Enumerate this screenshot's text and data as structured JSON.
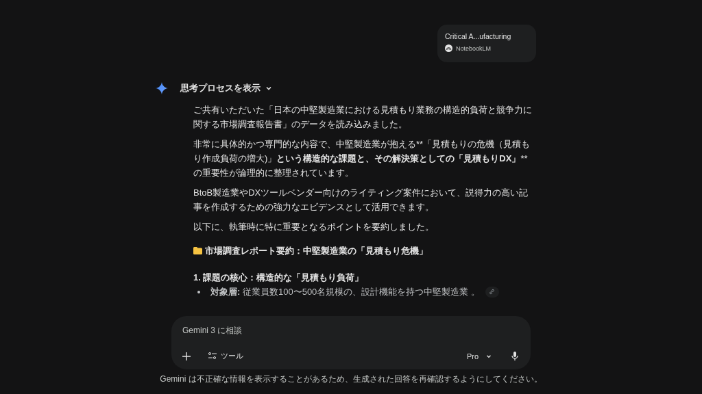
{
  "attachment": {
    "title": "Critical A...ufacturing",
    "source": "NotebookLM"
  },
  "thinking": {
    "label": "思考プロセスを表示",
    "expanded": false
  },
  "response": {
    "paragraphs": [
      [
        {
          "text": "ご共有いただいた「日本の中堅製造業における見積もり業務の構造的負荷と競争力に関する市場調査報告書」のデータを読み込みました。",
          "bold": false
        }
      ],
      [
        {
          "text": "非常に具体的かつ専門的な内容で、中堅製造業が抱える**「見積もりの危機（見積もり作成負荷の増大)」",
          "bold": false
        },
        {
          "text": "という構造的な課題と、その解決策としての「見積もりDX」",
          "bold": true
        },
        {
          "text": "**の重要性が論理的に整理されています。",
          "bold": false
        }
      ],
      [
        {
          "text": "BtoB製造業やDXツールベンダー向けのライティング案件において、説得力の高い記事を作成するための強力なエビデンスとして活用できます。",
          "bold": false
        }
      ],
      [
        {
          "text": "以下に、執筆時に特に重要となるポイントを要約しました。",
          "bold": false
        }
      ]
    ],
    "heading": "市場調査レポート要約：中堅製造業の「見積もり危機」",
    "section_title": "1. 課題の核心：構造的な「見積もり負荷」",
    "bullets": [
      [
        {
          "text": "対象層:",
          "bold": true
        },
        {
          "text": " 従業員数100〜500名規模の、設計機能を持つ中堅製造業 。",
          "bold": false
        }
      ]
    ]
  },
  "composer": {
    "placeholder": "Gemini 3 に相談",
    "tools_label": "ツール",
    "model": "Pro"
  },
  "disclaimer": "Gemini は不正確な情報を表示することがあるため、生成された回答を再確認するようにしてください。"
}
